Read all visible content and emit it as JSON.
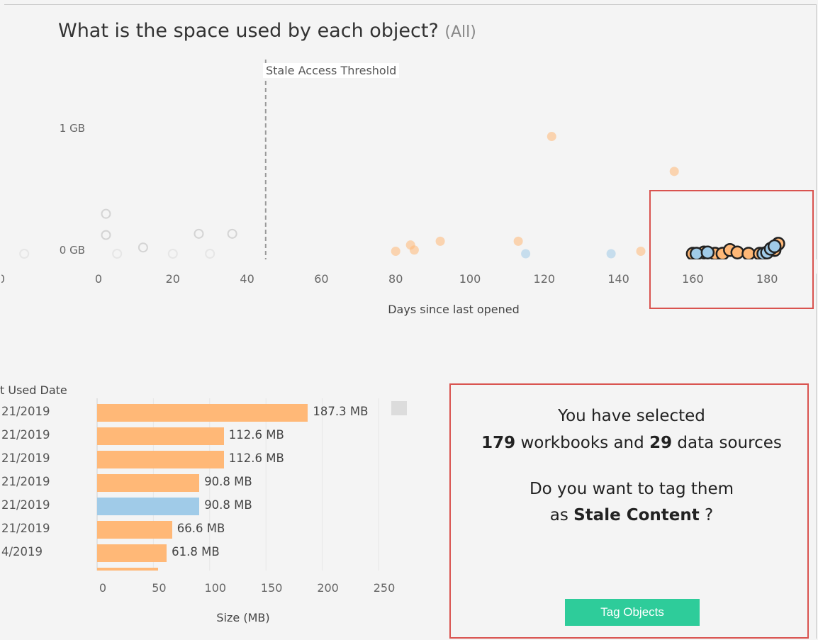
{
  "header": {
    "title": "What is the space used by each object?",
    "filter": "(All)"
  },
  "scatter": {
    "reference_line_label": "Stale  Access Threshold",
    "reference_line_value": 45,
    "y_ticks": [
      "1 GB",
      "0 GB"
    ],
    "x_ticks": [
      "0",
      "20",
      "40",
      "60",
      "80",
      "100",
      "120",
      "140",
      "160",
      "180"
    ],
    "x_tick_values": [
      0,
      20,
      40,
      60,
      80,
      100,
      120,
      140,
      160,
      180
    ],
    "x_axis_title": "Days since last opened",
    "colors": {
      "workbook": "#ffb877",
      "data_source": "#a0cbe8",
      "outline": "#222222"
    }
  },
  "bar_section": {
    "header": "t Used Date",
    "rows": [
      {
        "date": "21/2019",
        "value": 187.3,
        "label": "187.3 MB",
        "type": "workbook"
      },
      {
        "date": "21/2019",
        "value": 112.6,
        "label": "112.6 MB",
        "type": "workbook"
      },
      {
        "date": "21/2019",
        "value": 112.6,
        "label": "112.6 MB",
        "type": "workbook"
      },
      {
        "date": "21/2019",
        "value": 90.8,
        "label": "90.8 MB",
        "type": "workbook"
      },
      {
        "date": "21/2019",
        "value": 90.8,
        "label": "90.8 MB",
        "type": "data_source"
      },
      {
        "date": "21/2019",
        "value": 66.6,
        "label": "66.6 MB",
        "type": "workbook"
      },
      {
        "date": "4/2019",
        "value": 61.8,
        "label": "61.8 MB",
        "type": "workbook"
      }
    ],
    "x_ticks": [
      "0",
      "50",
      "100",
      "150",
      "200",
      "250"
    ],
    "x_axis_title": "Size (MB)"
  },
  "panel": {
    "line1": "You have selected",
    "workbooks_count": "179",
    "workbooks_text": " workbooks and ",
    "sources_count": "29",
    "sources_text": " data sources",
    "question": "Do you want to tag them",
    "as_text": "as ",
    "tag_name": "Stale Content",
    "question_mark": " ?",
    "button_label": "Tag Objects"
  },
  "chart_data": [
    {
      "type": "scatter",
      "title": "What is the space used by each object?",
      "xlabel": "Days since last opened",
      "ylabel": "",
      "xlim": [
        -2,
        188
      ],
      "y_ticks": [
        "0 GB",
        "1 GB"
      ],
      "reference_lines": [
        {
          "axis": "x",
          "value": 45,
          "label": "Stale  Access Threshold"
        }
      ],
      "series": [
        {
          "name": "",
          "x": [
            122,
            155,
            146,
            113,
            92,
            84,
            85,
            80,
            160,
            163,
            166,
            168,
            170,
            172,
            175,
            178,
            182,
            183
          ],
          "y": [
            0.94,
            0.66,
            0.02,
            0.1,
            0.1,
            0.07,
            0.03,
            0.02,
            0.0,
            0.01,
            0.0,
            0.0,
            0.03,
            0.01,
            0.0,
            0.0,
            0.03,
            0.08
          ]
        },
        {
          "name": "",
          "x": [
            115,
            138,
            161,
            164,
            179,
            180,
            181,
            182
          ],
          "y": [
            0.0,
            0.0,
            0.0,
            0.01,
            0.0,
            0.01,
            0.04,
            0.06
          ]
        }
      ]
    },
    {
      "type": "bar",
      "orientation": "horizontal",
      "xlabel": "Size (MB)",
      "categories": [
        "21/2019",
        "21/2019",
        "21/2019",
        "21/2019",
        "21/2019",
        "21/2019",
        "4/2019"
      ],
      "values": [
        187.3,
        112.6,
        112.6,
        90.8,
        90.8,
        66.6,
        61.8
      ],
      "xlim": [
        0,
        250
      ]
    }
  ]
}
